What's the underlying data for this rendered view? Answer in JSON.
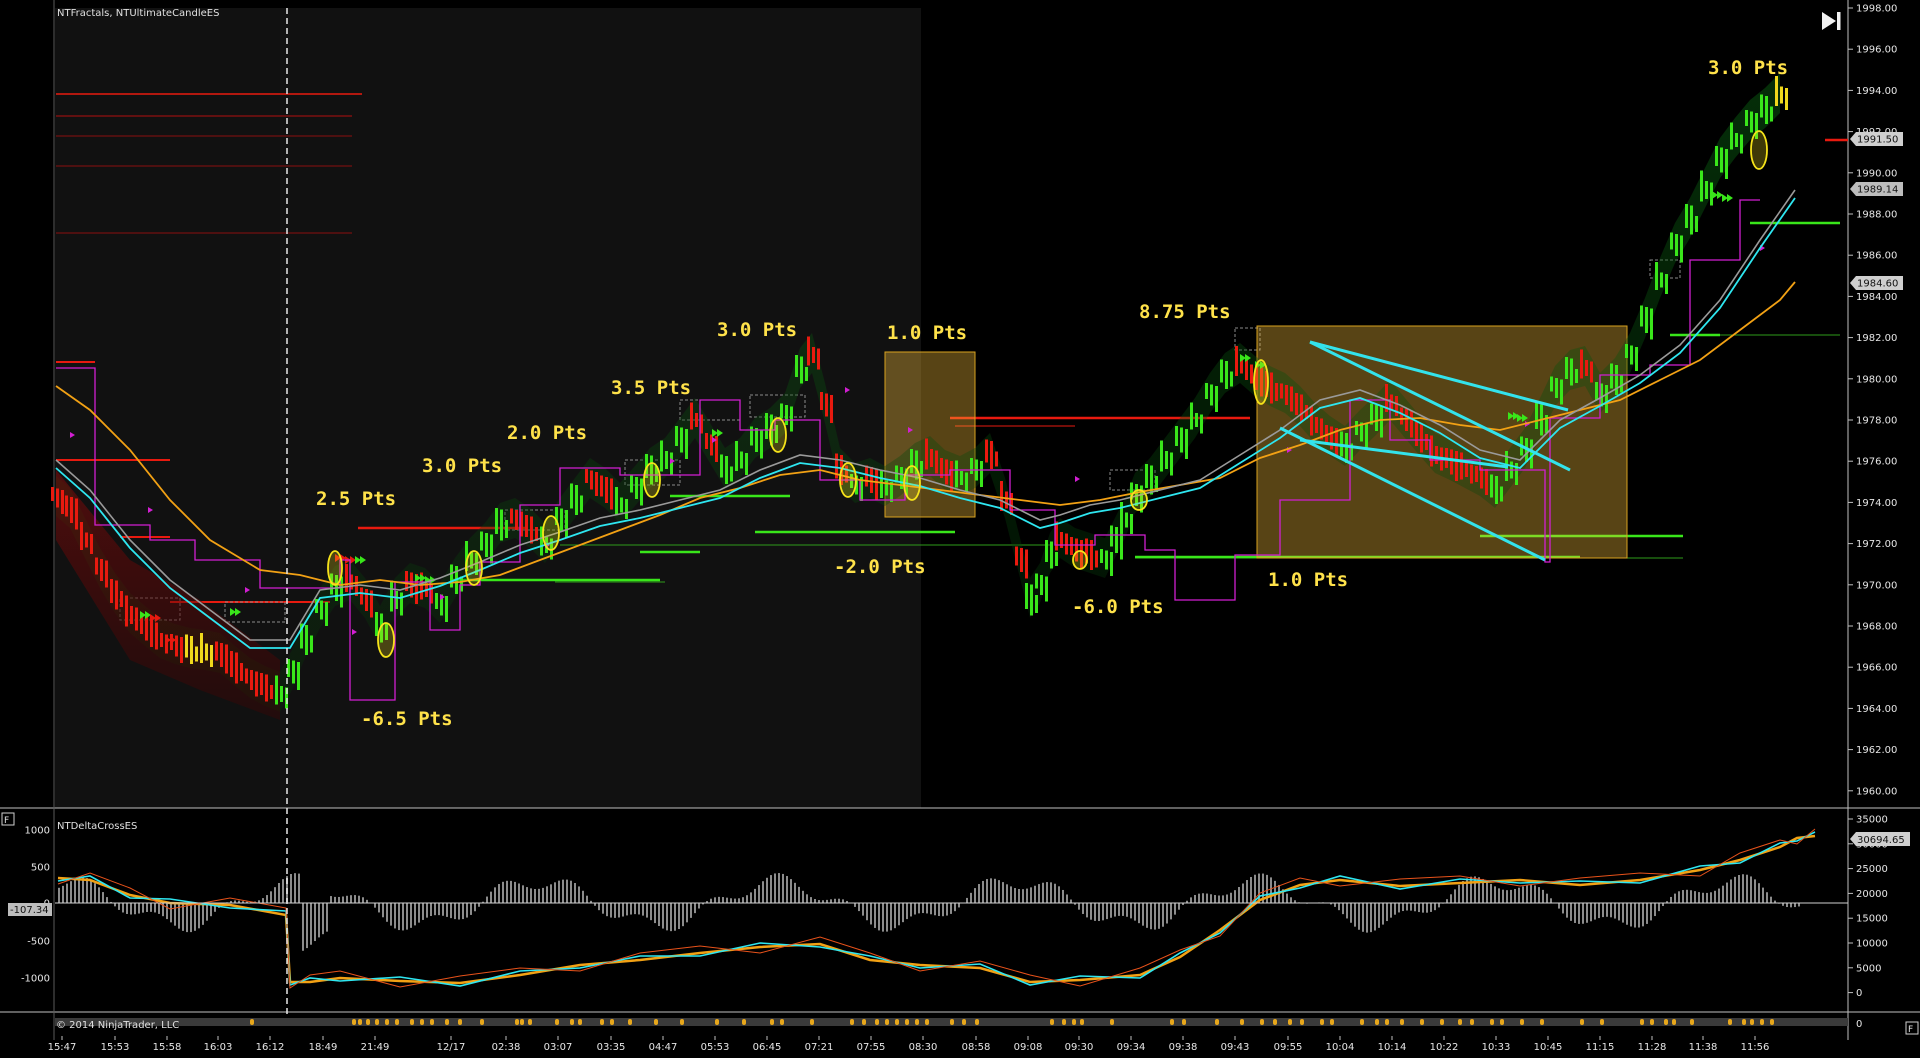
{
  "main_panel": {
    "indicator_label": "NTFractals, NTUltimateCandleES",
    "price_axis_labels": [
      "1998.00",
      "1996.00",
      "1994.00",
      "1992.00",
      "1990.00",
      "1988.00",
      "1986.00",
      "1984.00",
      "1982.00",
      "1980.00",
      "1978.00",
      "1976.00",
      "1974.00",
      "1972.00",
      "1970.00",
      "1968.00",
      "1966.00",
      "1964.00",
      "1962.00",
      "1960.00"
    ],
    "price_tags": [
      {
        "text": "1991.50",
        "color": "#cfcfcf"
      },
      {
        "text": "1989.14",
        "color": "#bdbdbd"
      },
      {
        "text": "1984.60",
        "color": "#cfcfcf"
      }
    ]
  },
  "annotations": [
    "3.0 Pts",
    "1.0 Pts",
    "8.75 Pts",
    "3.0 Pts",
    "3.5 Pts",
    "2.0 Pts",
    "3.0 Pts",
    "2.5 Pts",
    "-6.5 Pts",
    "-2.0 Pts",
    "-6.0 Pts",
    "1.0 Pts"
  ],
  "lower_panel": {
    "indicator_label": "NTDeltaCrossES",
    "left_axis_labels": [
      "1000",
      "500",
      "0",
      "-500",
      "-1000"
    ],
    "left_tag": "-107.34",
    "right_axis_labels": [
      "35000",
      "30000",
      "25000",
      "20000",
      "15000",
      "10000",
      "5000",
      "0"
    ],
    "right_tag": "30694.65"
  },
  "bottom_strip": {
    "copyright": "© 2014 NinjaTrader, LLC",
    "right_value": "0"
  },
  "time_axis_labels": [
    "15:47",
    "15:53",
    "15:58",
    "16:03",
    "16:12",
    "18:49",
    "21:49",
    "12/17",
    "02:38",
    "03:07",
    "03:35",
    "04:47",
    "05:53",
    "06:45",
    "07:21",
    "07:55",
    "08:30",
    "08:58",
    "09:08",
    "09:30",
    "09:34",
    "09:38",
    "09:43",
    "09:55",
    "10:04",
    "10:14",
    "10:22",
    "10:33",
    "10:45",
    "11:15",
    "11:28",
    "11:38",
    "11:56"
  ],
  "icons": {
    "panel_toggle_top": "F",
    "panel_toggle_bottom": "F",
    "jump_to_end": "skip-to-end-icon"
  },
  "colors": {
    "background": "#000000",
    "session_shade": "#111111",
    "annotation": "#ffe24a",
    "cyan_ma": "#2ee6f0",
    "orange_ma": "#f2a114",
    "up_bar": "#39e61a",
    "down_bar": "#e81a0f",
    "neutral_bar": "#f0d81c",
    "magenta": "#d21fd2",
    "box_fill": "#fcc43c"
  }
}
